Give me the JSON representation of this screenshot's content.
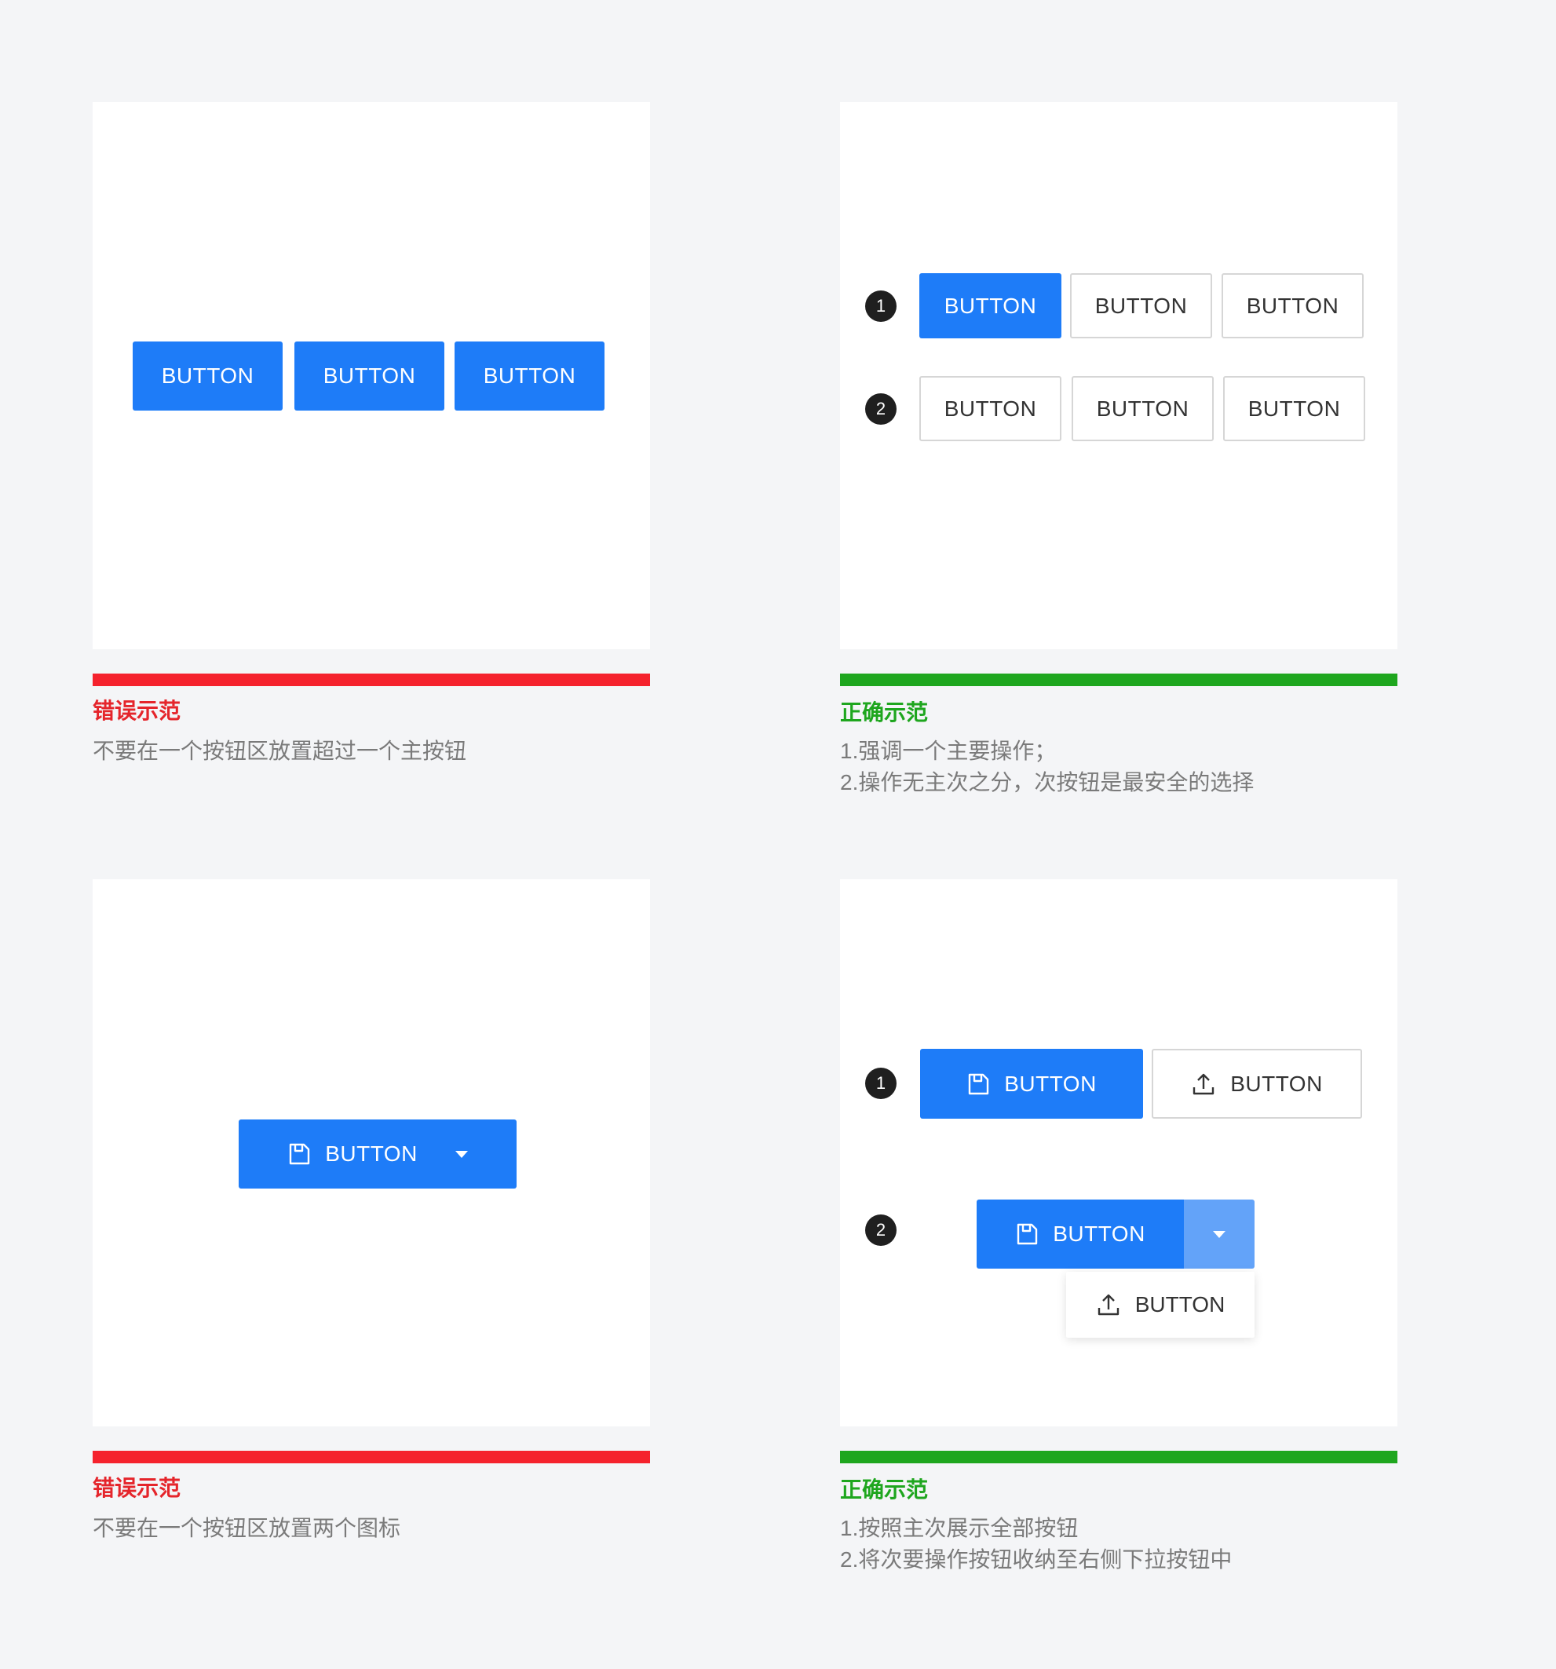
{
  "button_label": "BUTTON",
  "colors": {
    "primary": "#1e7cf8",
    "primary_light": "#63a3f9",
    "error": "#f5222d",
    "success": "#1ea61e",
    "background": "#f4f5f7"
  },
  "examples": [
    {
      "type": "wrong",
      "title": "错误示范",
      "desc": [
        "不要在一个按钮区放置超过一个主按钮"
      ]
    },
    {
      "type": "right",
      "title": "正确示范",
      "markers": [
        "1",
        "2"
      ],
      "desc": [
        "1.强调一个主要操作；",
        "2.操作无主次之分，次按钮是最安全的选择"
      ]
    },
    {
      "type": "wrong",
      "title": "错误示范",
      "desc": [
        "不要在一个按钮区放置两个图标"
      ]
    },
    {
      "type": "right",
      "title": "正确示范",
      "markers": [
        "1",
        "2"
      ],
      "desc": [
        "1.按照主次展示全部按钮",
        "2.将次要操作按钮收纳至右侧下拉按钮中"
      ]
    }
  ],
  "icons": {
    "save": "save-icon",
    "upload": "upload-icon",
    "dropdown": "caret-down-icon"
  }
}
